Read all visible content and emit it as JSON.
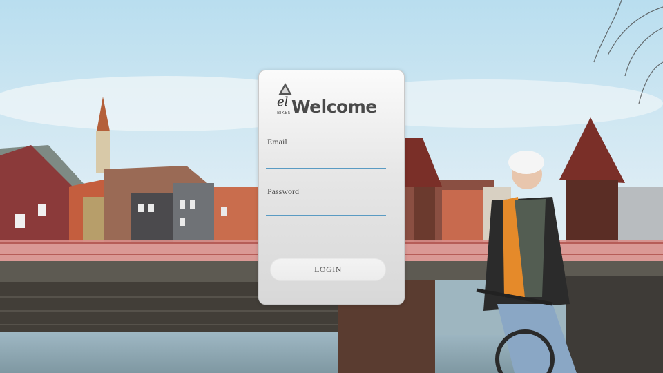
{
  "page": {
    "background": "trondheim-old-town-bridge-cyclist-photo"
  },
  "login_card": {
    "logo": {
      "script_text": "el",
      "tagline": "BIKES",
      "icon": "logo-triangle-icon"
    },
    "title": "Welcome",
    "email": {
      "label": "Email",
      "value": "",
      "placeholder": ""
    },
    "password": {
      "label": "Password",
      "value": "",
      "placeholder": ""
    },
    "login_button": "LOGIN"
  },
  "colors": {
    "field_underline": "#5a9bc3",
    "title_text": "#4a4a4a",
    "sky": "#c9e4f1"
  }
}
